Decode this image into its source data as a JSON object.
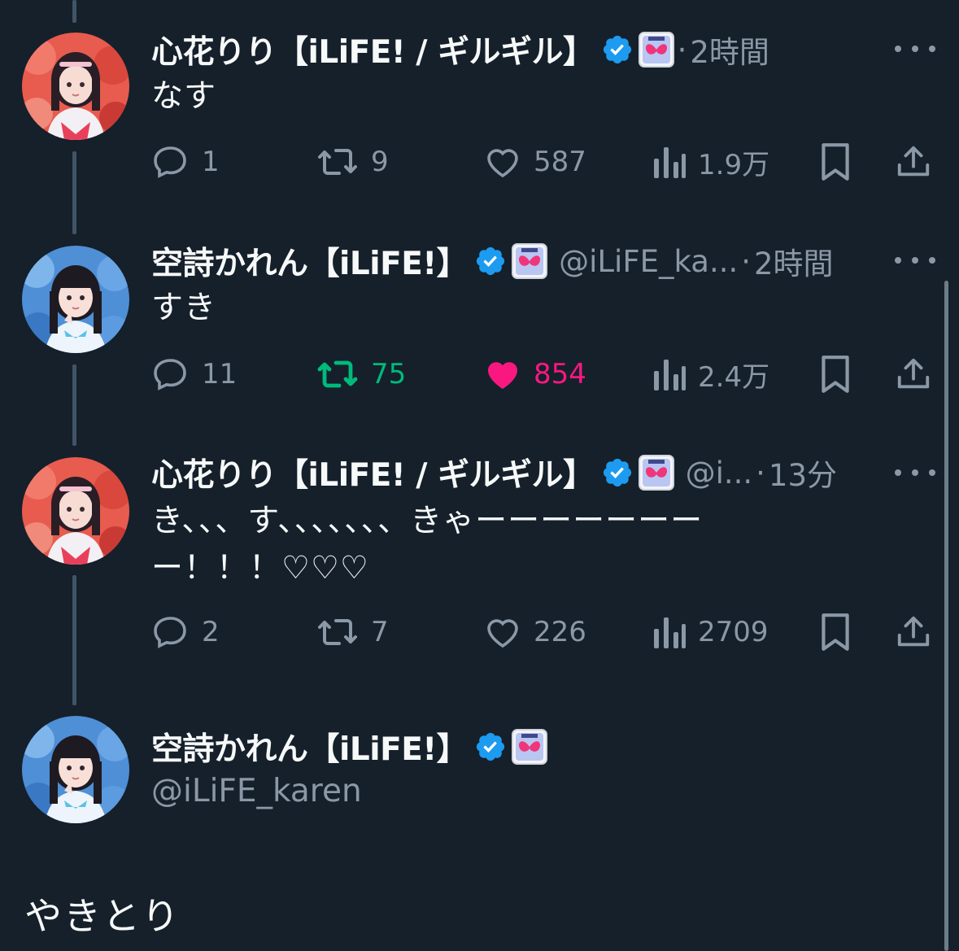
{
  "colors": {
    "background": "#15202b",
    "primary_text": "#f7f9f9",
    "secondary_text": "#8b98a5",
    "verified_blue": "#1d9bf0",
    "retweet_green": "#00ba7c",
    "like_pink": "#f91880",
    "thread_line": "#425466"
  },
  "tweets": [
    {
      "name": "心花りり【iLiFE! / ギルギル】",
      "handle": "",
      "dot": "·",
      "time": "2時間",
      "text": "なす",
      "verified_icon": "verified-badge-icon",
      "affiliate_icon": "affiliate-badge-icon",
      "stats": {
        "replies": "1",
        "retweets": "9",
        "likes": "587",
        "views": "1.9万"
      },
      "retweeted": false,
      "liked": false
    },
    {
      "name": "空詩かれん【iLiFE!】",
      "handle": "@iLiFE_ka...",
      "dot": "·",
      "time": "2時間",
      "text": "すき",
      "verified_icon": "verified-badge-icon",
      "affiliate_icon": "affiliate-badge-icon",
      "stats": {
        "replies": "11",
        "retweets": "75",
        "likes": "854",
        "views": "2.4万"
      },
      "retweeted": true,
      "liked": true
    },
    {
      "name": "心花りり【iLiFE! / ギルギル】",
      "handle": "@i...",
      "dot": "·",
      "time": "13分",
      "text_line1": "き、、、す、、、、、、、きゃーーーーーーー",
      "text_line2": "ー！！！♡♡♡",
      "verified_icon": "verified-badge-icon",
      "affiliate_icon": "affiliate-badge-icon",
      "stats": {
        "replies": "2",
        "retweets": "7",
        "likes": "226",
        "views": "2709"
      },
      "retweeted": false,
      "liked": false
    }
  ],
  "main_tweet": {
    "name": "空詩かれん【iLiFE!】",
    "handle": "@iLiFE_karen",
    "text": "やきとり",
    "verified_icon": "verified-badge-icon",
    "affiliate_icon": "affiliate-badge-icon"
  }
}
